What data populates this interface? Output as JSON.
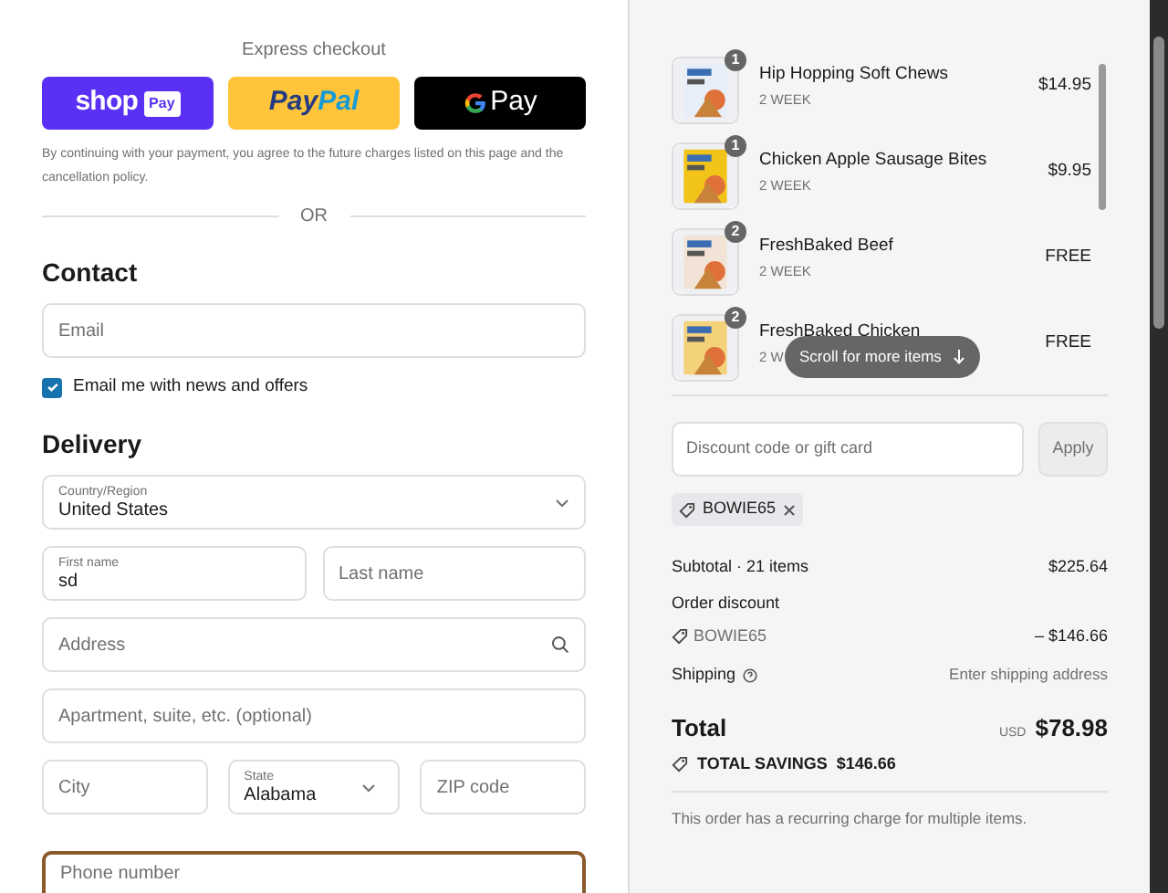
{
  "express_checkout": {
    "title": "Express checkout",
    "buttons": [
      {
        "kind": "shop_pay",
        "wordmark": "shop",
        "badge": "Pay"
      },
      {
        "kind": "paypal",
        "parts": [
          "Pay",
          "Pal"
        ]
      },
      {
        "kind": "google_pay",
        "label": "Pay"
      }
    ],
    "consent": "By continuing with your payment, you agree to the future charges listed on this page and the cancellation policy.",
    "divider": "OR"
  },
  "contact": {
    "heading": "Contact",
    "email": {
      "placeholder": "Email"
    },
    "newsletter": {
      "label": "Email me with news and offers",
      "checked": true
    }
  },
  "delivery": {
    "heading": "Delivery",
    "country": {
      "label": "Country/Region",
      "value": "United States"
    },
    "first_name": {
      "label": "First name",
      "value": "sd"
    },
    "last_name": {
      "placeholder": "Last name"
    },
    "address": {
      "placeholder": "Address"
    },
    "apartment": {
      "placeholder": "Apartment, suite, etc. (optional)"
    },
    "city": {
      "placeholder": "City"
    },
    "state": {
      "label": "State",
      "value": "Alabama"
    },
    "zip": {
      "placeholder": "ZIP code"
    },
    "phone": {
      "placeholder": "Phone number",
      "focused": true
    }
  },
  "summary": {
    "line_items": [
      {
        "name": "Hip Hopping Soft Chews",
        "plan": "2 WEEK",
        "price": "$14.95",
        "quantity": "1",
        "color": "#e8eef7"
      },
      {
        "name": "Chicken Apple Sausage Bites",
        "plan": "2 WEEK",
        "price": "$9.95",
        "quantity": "1",
        "color": "#f2c318"
      },
      {
        "name": "FreshBaked Beef",
        "plan": "2 WEEK",
        "price": "FREE",
        "quantity": "2",
        "color": "#f1e4d6"
      },
      {
        "name": "FreshBaked Chicken",
        "plan": "2 W",
        "price": "FREE",
        "quantity": "2",
        "color": "#f4d27a"
      }
    ],
    "scroll_hint": "Scroll for more items",
    "discount": {
      "placeholder": "Discount code or gift card",
      "button": "Apply"
    },
    "applied_code": "BOWIE65",
    "subtotal": {
      "label": "Subtotal · 21 items",
      "value": "$225.64"
    },
    "order_discount": {
      "label": "Order discount",
      "code": "BOWIE65",
      "value": "– $146.66"
    },
    "shipping": {
      "label": "Shipping",
      "value": "Enter shipping address"
    },
    "total": {
      "label": "Total",
      "currency": "USD",
      "value": "$78.98"
    },
    "savings": {
      "label": "TOTAL SAVINGS",
      "value": "$146.66"
    },
    "note": "This order has a recurring charge for multiple items."
  }
}
